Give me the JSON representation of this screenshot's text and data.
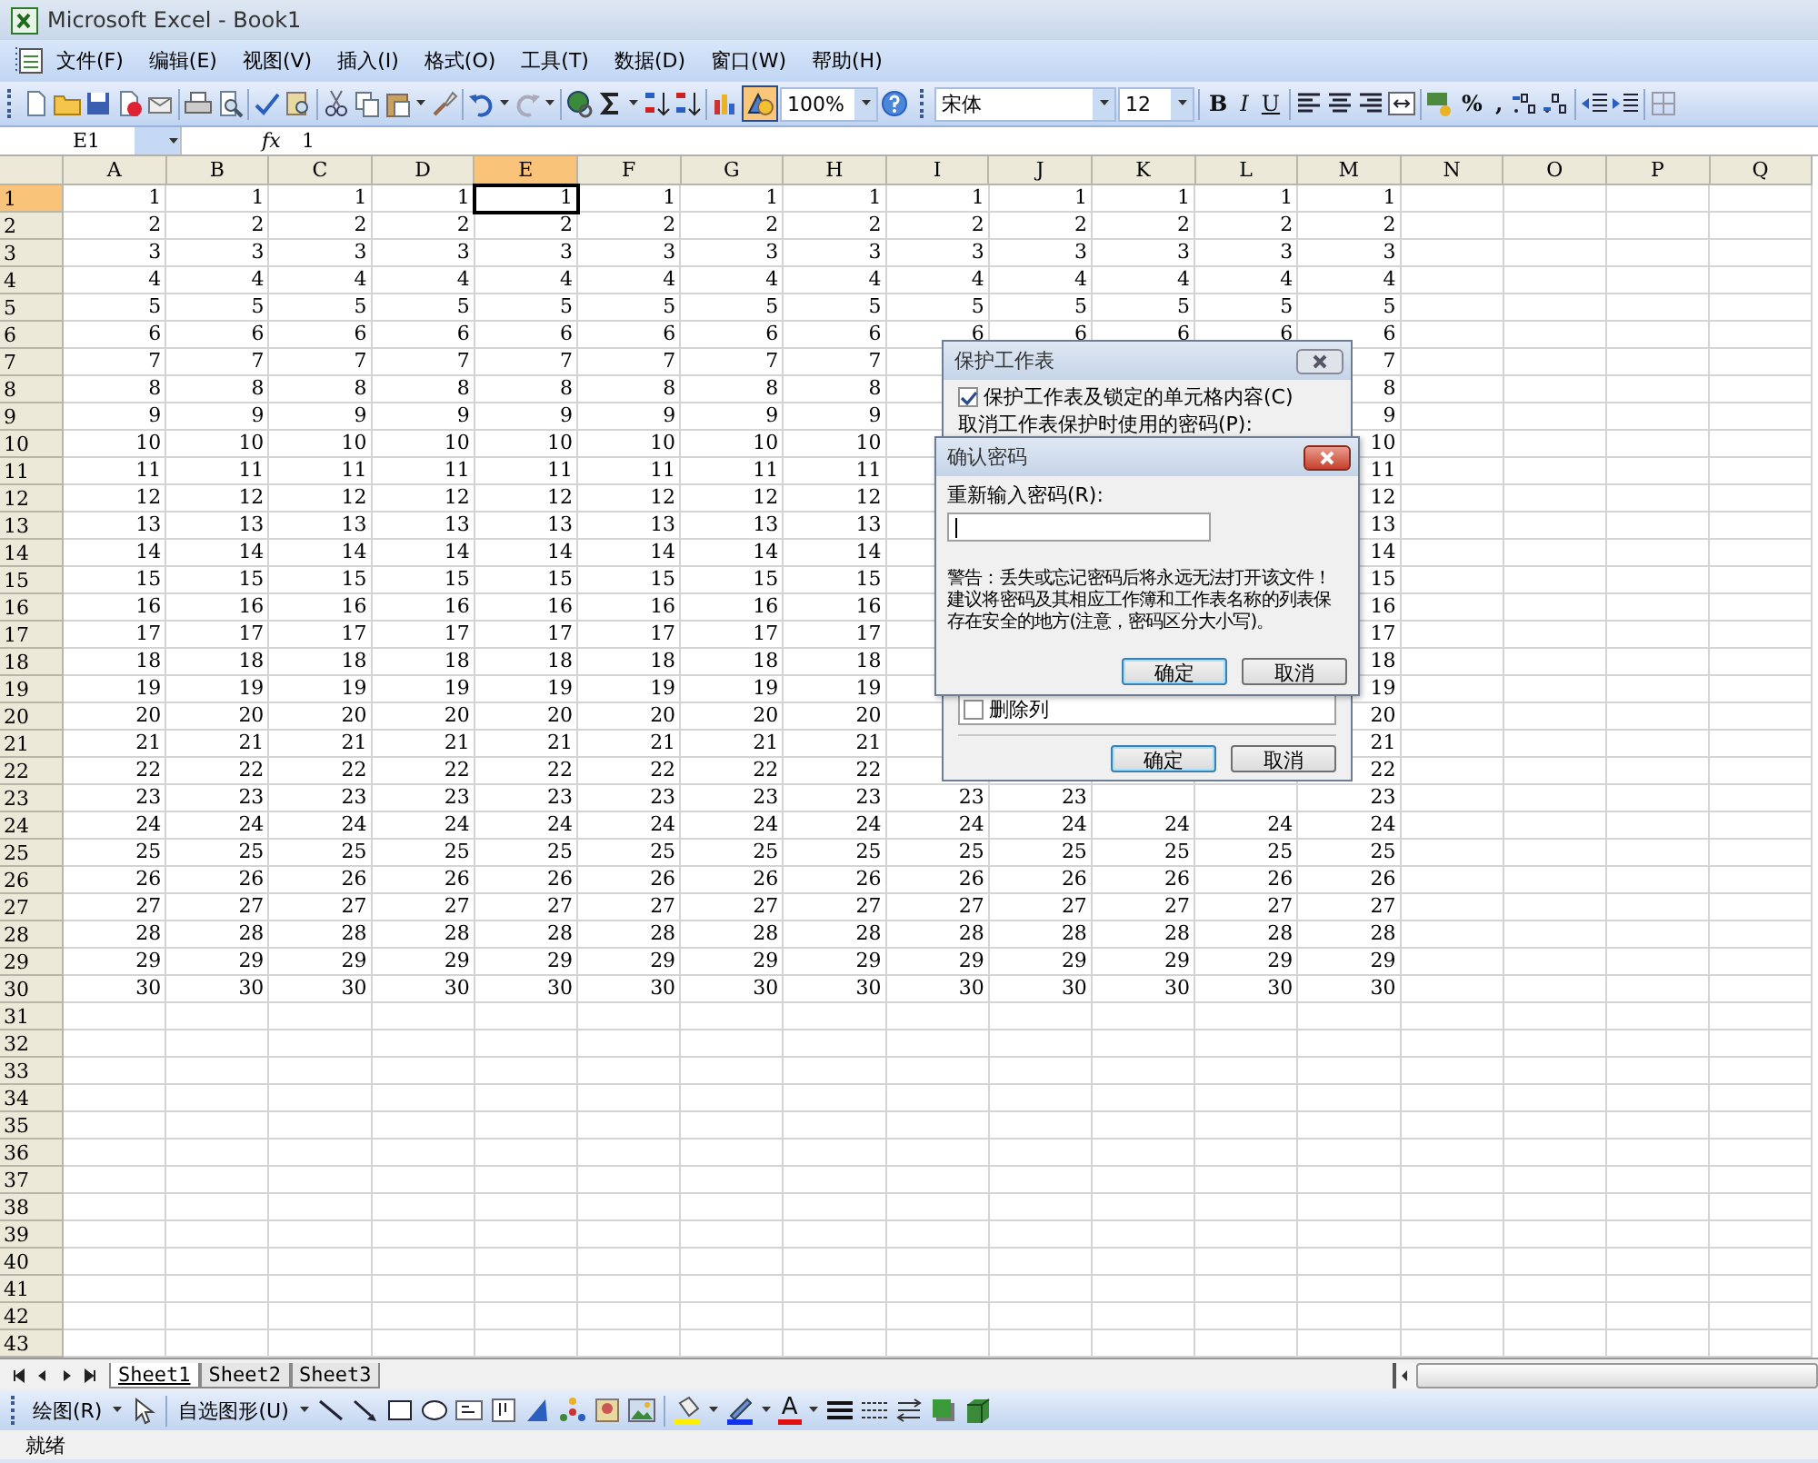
{
  "window": {
    "title": "Microsoft Excel - Book1"
  },
  "menu": [
    "文件(F)",
    "编辑(E)",
    "视图(V)",
    "插入(I)",
    "格式(O)",
    "工具(T)",
    "数据(D)",
    "窗口(W)",
    "帮助(H)"
  ],
  "standard_toolbar": {
    "drawing_on": true,
    "zoom": "100%"
  },
  "formatting_toolbar": {
    "font": "宋体",
    "size": "12",
    "style_buttons": [
      "B",
      "I",
      "U"
    ],
    "number_buttons": [
      "%",
      ","
    ]
  },
  "formula_bar": {
    "name_box": "E1",
    "fx": "fx",
    "value": "1"
  },
  "sheet": {
    "columns": [
      {
        "label": "A",
        "selected": false
      },
      {
        "label": "B",
        "selected": false
      },
      {
        "label": "C",
        "selected": false
      },
      {
        "label": "D",
        "selected": false
      },
      {
        "label": "E",
        "selected": true
      },
      {
        "label": "F",
        "selected": false
      },
      {
        "label": "G",
        "selected": false
      },
      {
        "label": "H",
        "selected": false
      },
      {
        "label": "I",
        "selected": false
      },
      {
        "label": "J",
        "selected": false
      },
      {
        "label": "K",
        "selected": false
      },
      {
        "label": "L",
        "selected": false
      },
      {
        "label": "M",
        "selected": false
      },
      {
        "label": "N",
        "selected": false
      },
      {
        "label": "O",
        "selected": false
      },
      {
        "label": "P",
        "selected": false
      },
      {
        "label": "Q",
        "selected": false
      }
    ],
    "rows": [
      {
        "header": "1",
        "selected": true,
        "cells": [
          "1",
          "1",
          "1",
          "1",
          "1",
          "1",
          "1",
          "1",
          "1",
          "1",
          "1",
          "1",
          "1"
        ]
      },
      {
        "header": "2",
        "selected": false,
        "cells": [
          "2",
          "2",
          "2",
          "2",
          "2",
          "2",
          "2",
          "2",
          "2",
          "2",
          "2",
          "2",
          "2"
        ]
      },
      {
        "header": "3",
        "selected": false,
        "cells": [
          "3",
          "3",
          "3",
          "3",
          "3",
          "3",
          "3",
          "3",
          "3",
          "3",
          "3",
          "3",
          "3"
        ]
      },
      {
        "header": "4",
        "selected": false,
        "cells": [
          "4",
          "4",
          "4",
          "4",
          "4",
          "4",
          "4",
          "4",
          "4",
          "4",
          "4",
          "4",
          "4"
        ]
      },
      {
        "header": "5",
        "selected": false,
        "cells": [
          "5",
          "5",
          "5",
          "5",
          "5",
          "5",
          "5",
          "5",
          "5",
          "5",
          "5",
          "5",
          "5"
        ]
      },
      {
        "header": "6",
        "selected": false,
        "cells": [
          "6",
          "6",
          "6",
          "6",
          "6",
          "6",
          "6",
          "6",
          "6",
          "6",
          "6",
          "6",
          "6"
        ]
      },
      {
        "header": "7",
        "selected": false,
        "cells": [
          "7",
          "7",
          "7",
          "7",
          "7",
          "7",
          "7",
          "7",
          null,
          null,
          null,
          null,
          "7"
        ]
      },
      {
        "header": "8",
        "selected": false,
        "cells": [
          "8",
          "8",
          "8",
          "8",
          "8",
          "8",
          "8",
          "8",
          null,
          null,
          null,
          null,
          "8"
        ]
      },
      {
        "header": "9",
        "selected": false,
        "cells": [
          "9",
          "9",
          "9",
          "9",
          "9",
          "9",
          "9",
          "9",
          null,
          null,
          null,
          null,
          "9"
        ]
      },
      {
        "header": "10",
        "selected": false,
        "cells": [
          "10",
          "10",
          "10",
          "10",
          "10",
          "10",
          "10",
          "10",
          null,
          null,
          null,
          null,
          "10"
        ]
      },
      {
        "header": "11",
        "selected": false,
        "cells": [
          "11",
          "11",
          "11",
          "11",
          "11",
          "11",
          "11",
          "11",
          null,
          null,
          null,
          null,
          "11"
        ]
      },
      {
        "header": "12",
        "selected": false,
        "cells": [
          "12",
          "12",
          "12",
          "12",
          "12",
          "12",
          "12",
          "12",
          null,
          null,
          null,
          null,
          "12"
        ]
      },
      {
        "header": "13",
        "selected": false,
        "cells": [
          "13",
          "13",
          "13",
          "13",
          "13",
          "13",
          "13",
          "13",
          null,
          null,
          null,
          null,
          "13"
        ]
      },
      {
        "header": "14",
        "selected": false,
        "cells": [
          "14",
          "14",
          "14",
          "14",
          "14",
          "14",
          "14",
          "14",
          null,
          null,
          null,
          null,
          "14"
        ]
      },
      {
        "header": "15",
        "selected": false,
        "cells": [
          "15",
          "15",
          "15",
          "15",
          "15",
          "15",
          "15",
          "15",
          null,
          null,
          null,
          null,
          "15"
        ]
      },
      {
        "header": "16",
        "selected": false,
        "cells": [
          "16",
          "16",
          "16",
          "16",
          "16",
          "16",
          "16",
          "16",
          null,
          null,
          null,
          null,
          "16"
        ]
      },
      {
        "header": "17",
        "selected": false,
        "cells": [
          "17",
          "17",
          "17",
          "17",
          "17",
          "17",
          "17",
          "17",
          null,
          null,
          null,
          null,
          "17"
        ]
      },
      {
        "header": "18",
        "selected": false,
        "cells": [
          "18",
          "18",
          "18",
          "18",
          "18",
          "18",
          "18",
          "18",
          null,
          null,
          null,
          null,
          "18"
        ]
      },
      {
        "header": "19",
        "selected": false,
        "cells": [
          "19",
          "19",
          "19",
          "19",
          "19",
          "19",
          "19",
          "19",
          null,
          null,
          null,
          null,
          "19"
        ]
      },
      {
        "header": "20",
        "selected": false,
        "cells": [
          "20",
          "20",
          "20",
          "20",
          "20",
          "20",
          "20",
          "20",
          null,
          null,
          null,
          null,
          "20"
        ]
      },
      {
        "header": "21",
        "selected": false,
        "cells": [
          "21",
          "21",
          "21",
          "21",
          "21",
          "21",
          "21",
          "21",
          null,
          null,
          null,
          null,
          "21"
        ]
      },
      {
        "header": "22",
        "selected": false,
        "cells": [
          "22",
          "22",
          "22",
          "22",
          "22",
          "22",
          "22",
          "22",
          null,
          null,
          null,
          null,
          "22"
        ]
      },
      {
        "header": "23",
        "selected": false,
        "cells": [
          "23",
          "23",
          "23",
          "23",
          "23",
          "23",
          "23",
          "23",
          "23",
          "23",
          null,
          null,
          "23"
        ]
      },
      {
        "header": "24",
        "selected": false,
        "cells": [
          "24",
          "24",
          "24",
          "24",
          "24",
          "24",
          "24",
          "24",
          "24",
          "24",
          "24",
          "24",
          "24"
        ]
      },
      {
        "header": "25",
        "selected": false,
        "cells": [
          "25",
          "25",
          "25",
          "25",
          "25",
          "25",
          "25",
          "25",
          "25",
          "25",
          "25",
          "25",
          "25"
        ]
      },
      {
        "header": "26",
        "selected": false,
        "cells": [
          "26",
          "26",
          "26",
          "26",
          "26",
          "26",
          "26",
          "26",
          "26",
          "26",
          "26",
          "26",
          "26"
        ]
      },
      {
        "header": "27",
        "selected": false,
        "cells": [
          "27",
          "27",
          "27",
          "27",
          "27",
          "27",
          "27",
          "27",
          "27",
          "27",
          "27",
          "27",
          "27"
        ]
      },
      {
        "header": "28",
        "selected": false,
        "cells": [
          "28",
          "28",
          "28",
          "28",
          "28",
          "28",
          "28",
          "28",
          "28",
          "28",
          "28",
          "28",
          "28"
        ]
      },
      {
        "header": "29",
        "selected": false,
        "cells": [
          "29",
          "29",
          "29",
          "29",
          "29",
          "29",
          "29",
          "29",
          "29",
          "29",
          "29",
          "29",
          "29"
        ]
      },
      {
        "header": "30",
        "selected": false,
        "cells": [
          "30",
          "30",
          "30",
          "30",
          "30",
          "30",
          "30",
          "30",
          "30",
          "30",
          "30",
          "30",
          "30"
        ]
      },
      {
        "header": "31",
        "selected": false,
        "cells": []
      },
      {
        "header": "32",
        "selected": false,
        "cells": []
      },
      {
        "header": "33",
        "selected": false,
        "cells": []
      },
      {
        "header": "34",
        "selected": false,
        "cells": []
      },
      {
        "header": "35",
        "selected": false,
        "cells": []
      },
      {
        "header": "36",
        "selected": false,
        "cells": []
      },
      {
        "header": "37",
        "selected": false,
        "cells": []
      },
      {
        "header": "38",
        "selected": false,
        "cells": []
      },
      {
        "header": "39",
        "selected": false,
        "cells": []
      },
      {
        "header": "40",
        "selected": false,
        "cells": []
      },
      {
        "header": "41",
        "selected": false,
        "cells": []
      },
      {
        "header": "42",
        "selected": false,
        "cells": []
      },
      {
        "header": "43",
        "selected": false,
        "cells": []
      }
    ]
  },
  "sheet_tabs": [
    {
      "label": "Sheet1",
      "selected": true
    },
    {
      "label": "Sheet2",
      "selected": false
    },
    {
      "label": "Sheet3",
      "selected": false
    }
  ],
  "drawing_toolbar": {
    "draw_menu": "绘图(R)",
    "autoshapes_menu": "自选图形(U)",
    "font_color": "A"
  },
  "status_bar": "就绪",
  "protect_dialog": {
    "title": "保护工作表",
    "protect_checkbox": {
      "label": "保护工作表及锁定的单元格内容(C)",
      "checked": true
    },
    "password_label": "取消工作表保护时使用的密码(P):",
    "permissions": [
      {
        "label": "删除列",
        "checked": false
      }
    ],
    "buttons": [
      "确定",
      "取消"
    ]
  },
  "confirm_dialog": {
    "title": "确认密码",
    "label": "重新输入密码(R):",
    "warning": "警告：丢失或忘记密码后将永远无法打开该文件！建议将密码及其相应工作簿和工作表名称的列表保存在安全的地方(注意，密码区分大小写)。",
    "buttons": [
      "确定",
      "取消"
    ]
  }
}
